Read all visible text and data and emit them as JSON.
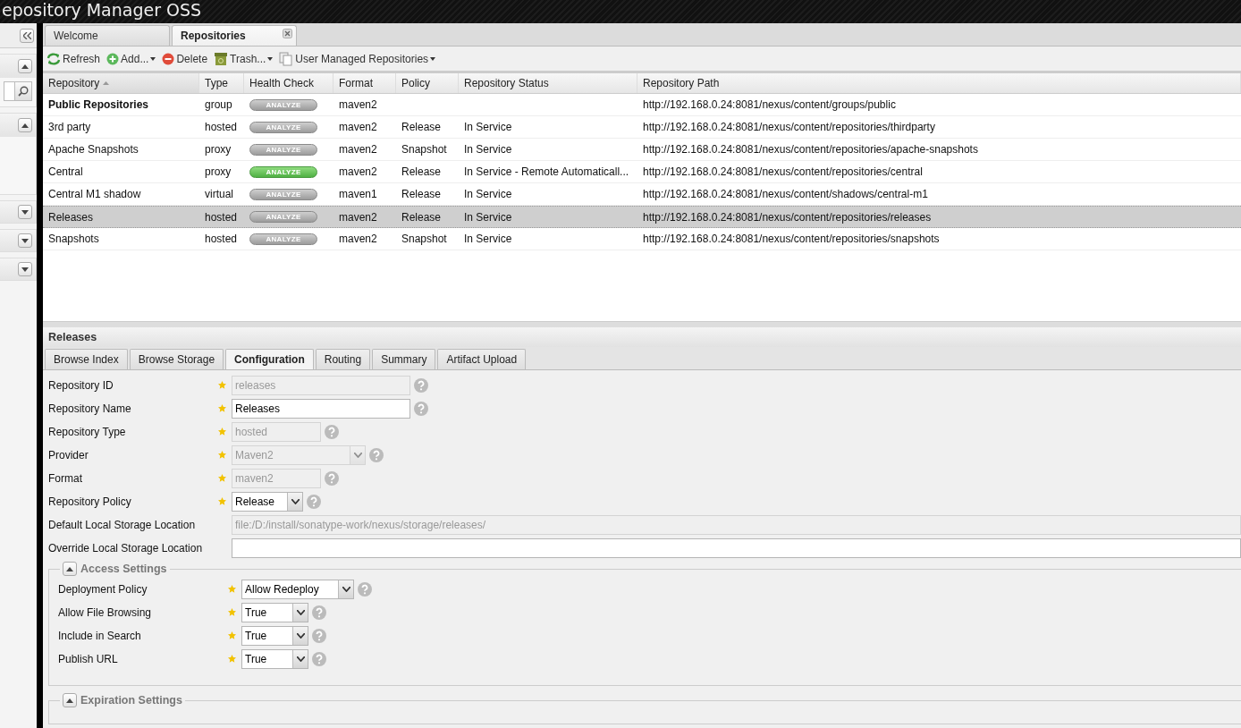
{
  "app_title": "epository Manager OSS",
  "sidebar": {
    "panels": [
      {
        "kind": "search",
        "expanded": true
      },
      {
        "kind": "empty",
        "expanded": true
      },
      {
        "kind": "empty",
        "expanded": false
      },
      {
        "kind": "empty",
        "expanded": false
      },
      {
        "kind": "empty",
        "expanded": false
      }
    ]
  },
  "tabs": [
    {
      "label": "Welcome",
      "selected": false,
      "closable": false
    },
    {
      "label": "Repositories",
      "selected": true,
      "closable": true
    }
  ],
  "toolbar": [
    {
      "label": "Refresh",
      "menu": false
    },
    {
      "label": "Add...",
      "menu": true
    },
    {
      "label": "Delete",
      "menu": false
    },
    {
      "label": "Trash...",
      "menu": true
    },
    {
      "label": "User Managed Repositories",
      "menu": true
    }
  ],
  "table": {
    "columns": [
      {
        "label": "Repository",
        "sorted": true
      },
      {
        "label": "Type",
        "sorted": false
      },
      {
        "label": "Health Check",
        "sorted": false
      },
      {
        "label": "Format",
        "sorted": false
      },
      {
        "label": "Policy",
        "sorted": false
      },
      {
        "label": "Repository Status",
        "sorted": false
      },
      {
        "label": "Repository Path",
        "sorted": false
      }
    ],
    "rows": [
      {
        "repository": "Public Repositories",
        "bold": true,
        "type": "group",
        "health": "ANALYZE",
        "health_active": false,
        "format": "maven2",
        "path": "http://192.168.0.24:8081/nexus/content/groups/public",
        "selected": false
      },
      {
        "repository": "3rd party",
        "bold": false,
        "type": "hosted",
        "health": "ANALYZE",
        "health_active": false,
        "format": "maven2",
        "policy": "Release",
        "status": "In Service",
        "path": "http://192.168.0.24:8081/nexus/content/repositories/thirdparty",
        "selected": false
      },
      {
        "repository": "Apache Snapshots",
        "bold": false,
        "type": "proxy",
        "health": "ANALYZE",
        "health_active": false,
        "format": "maven2",
        "policy": "Snapshot",
        "status": "In Service",
        "path": "http://192.168.0.24:8081/nexus/content/repositories/apache-snapshots",
        "selected": false
      },
      {
        "repository": "Central",
        "bold": false,
        "type": "proxy",
        "health": "ANALYZE",
        "health_active": true,
        "format": "maven2",
        "policy": "Release",
        "status": "In Service - Remote Automaticall...",
        "path": "http://192.168.0.24:8081/nexus/content/repositories/central",
        "selected": false
      },
      {
        "repository": "Central M1 shadow",
        "bold": false,
        "type": "virtual",
        "health": "ANALYZE",
        "health_active": false,
        "format": "maven1",
        "policy": "Release",
        "status": "In Service",
        "path": "http://192.168.0.24:8081/nexus/content/shadows/central-m1",
        "selected": false
      },
      {
        "repository": "Releases",
        "bold": false,
        "type": "hosted",
        "health": "ANALYZE",
        "health_active": false,
        "format": "maven2",
        "policy": "Release",
        "status": "In Service",
        "path": "http://192.168.0.24:8081/nexus/content/repositories/releases",
        "selected": true
      },
      {
        "repository": "Snapshots",
        "bold": false,
        "type": "hosted",
        "health": "ANALYZE",
        "health_active": false,
        "format": "maven2",
        "policy": "Snapshot",
        "status": "In Service",
        "path": "http://192.168.0.24:8081/nexus/content/repositories/snapshots",
        "selected": false
      }
    ]
  },
  "detail": {
    "title": "Releases",
    "tabs": [
      {
        "label": "Browse Index",
        "selected": false
      },
      {
        "label": "Browse Storage",
        "selected": false
      },
      {
        "label": "Configuration",
        "selected": true
      },
      {
        "label": "Routing",
        "selected": false
      },
      {
        "label": "Summary",
        "selected": false
      },
      {
        "label": "Artifact Upload",
        "selected": false
      }
    ],
    "fields": [
      {
        "label": "Repository ID",
        "kind": "text",
        "required": true,
        "disabled": true,
        "help": true,
        "value": "releases"
      },
      {
        "label": "Repository Name",
        "kind": "text",
        "required": true,
        "disabled": false,
        "help": true,
        "value": "Releases"
      },
      {
        "label": "Repository Type",
        "kind": "text",
        "required": true,
        "disabled": true,
        "help": true,
        "value": "hosted"
      },
      {
        "label": "Provider",
        "kind": "select",
        "required": true,
        "disabled": true,
        "help": true,
        "value": "Maven2"
      },
      {
        "label": "Format",
        "kind": "text",
        "required": true,
        "disabled": true,
        "help": true,
        "value": "maven2"
      },
      {
        "label": "Repository Policy",
        "kind": "select",
        "required": true,
        "disabled": false,
        "help": true,
        "value": "Release"
      },
      {
        "label": "Default Local Storage Location",
        "kind": "text",
        "required": false,
        "disabled": true,
        "help": false,
        "value": "file:/D:/install/sonatype-work/nexus/storage/releases/"
      },
      {
        "label": "Override Local Storage Location",
        "kind": "text",
        "required": false,
        "disabled": false,
        "help": false
      }
    ],
    "sections": [
      {
        "legend": "Access Settings",
        "expanded": true,
        "fields": [
          {
            "label": "Deployment Policy",
            "kind": "select",
            "required": true,
            "disabled": false,
            "help": true,
            "value": "Allow Redeploy"
          },
          {
            "label": "Allow File Browsing",
            "kind": "select",
            "required": true,
            "disabled": false,
            "help": true,
            "value": "True"
          },
          {
            "label": "Include in Search",
            "kind": "select",
            "required": true,
            "disabled": false,
            "help": true,
            "value": "True"
          },
          {
            "label": "Publish URL",
            "kind": "select",
            "required": true,
            "disabled": false,
            "help": true,
            "value": "True"
          }
        ]
      },
      {
        "legend": "Expiration Settings",
        "expanded": true
      }
    ]
  }
}
